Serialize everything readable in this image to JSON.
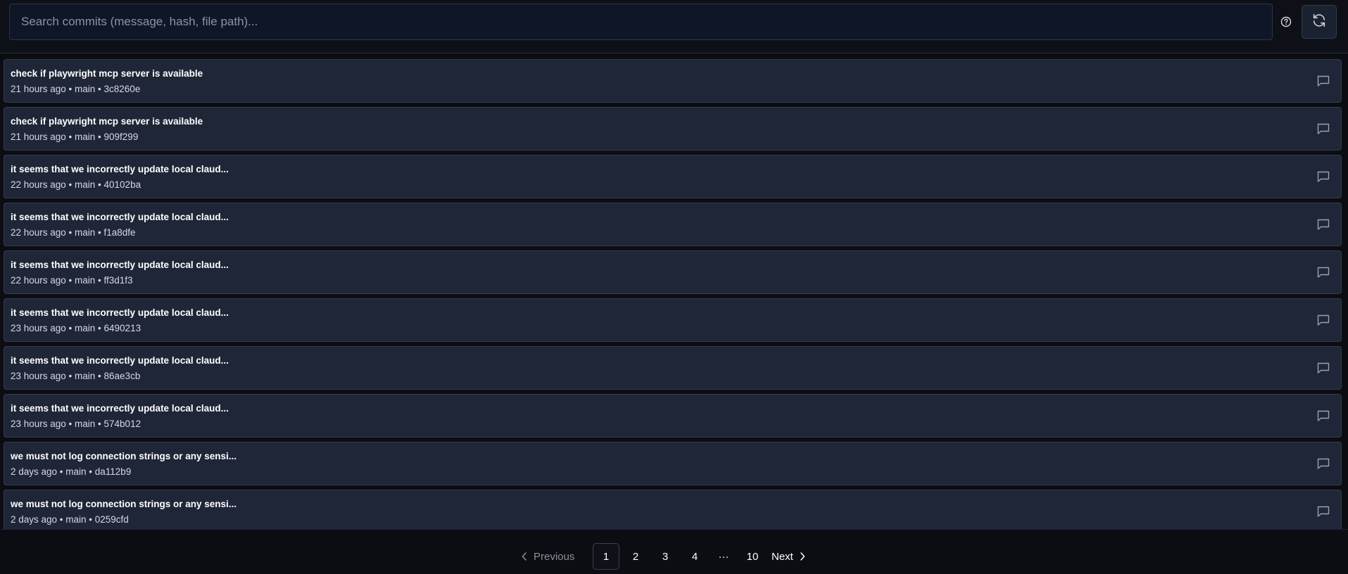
{
  "search": {
    "placeholder": "Search commits (message, hash, file path)...",
    "value": ""
  },
  "icons": {
    "help": "help-circle-icon",
    "refresh": "refresh-icon",
    "comment": "comment-icon",
    "prev": "chevron-left-icon",
    "next": "chevron-right-icon"
  },
  "commits": [
    {
      "title": "check if playwright mcp server is available",
      "meta": "21 hours ago • main • 3c8260e"
    },
    {
      "title": "check if playwright mcp server is available",
      "meta": "21 hours ago • main • 909f299"
    },
    {
      "title": "it seems that we incorrectly update local claud...",
      "meta": "22 hours ago • main • 40102ba"
    },
    {
      "title": "it seems that we incorrectly update local claud...",
      "meta": "22 hours ago • main • f1a8dfe"
    },
    {
      "title": "it seems that we incorrectly update local claud...",
      "meta": "22 hours ago • main • ff3d1f3"
    },
    {
      "title": "it seems that we incorrectly update local claud...",
      "meta": "23 hours ago • main • 6490213"
    },
    {
      "title": "it seems that we incorrectly update local claud...",
      "meta": "23 hours ago • main • 86ae3cb"
    },
    {
      "title": "it seems that we incorrectly update local claud...",
      "meta": "23 hours ago • main • 574b012"
    },
    {
      "title": "we must not log connection strings or any sensi...",
      "meta": "2 days ago • main • da112b9"
    },
    {
      "title": "we must not log connection strings or any sensi...",
      "meta": "2 days ago • main • 0259cfd"
    }
  ],
  "pagination": {
    "previous_label": "Previous",
    "next_label": "Next",
    "pages": [
      "1",
      "2",
      "3",
      "4"
    ],
    "ellipsis": "···",
    "last_page": "10",
    "current_page": "1"
  }
}
